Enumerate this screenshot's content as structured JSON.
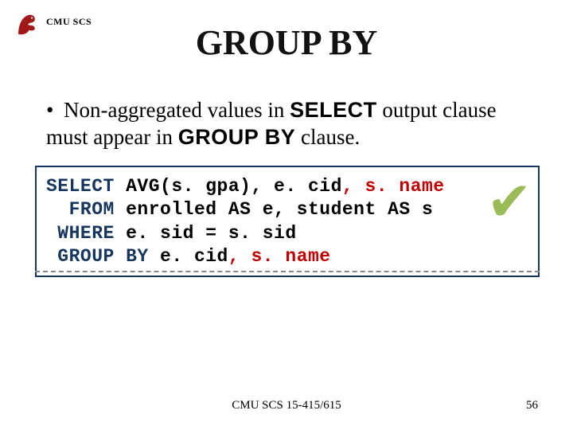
{
  "header": {
    "org": "CMU SCS"
  },
  "title": "GROUP BY",
  "bullet": {
    "pre": "Non-aggregated values in ",
    "kw1": "SELECT",
    "mid": " output clause must appear in ",
    "kw2": "GROUP BY",
    "post": " clause."
  },
  "code": {
    "l1_kw": "SELECT",
    "l1_rest": " AVG(s. gpa), e. cid",
    "l1_hl": ", s. name",
    "l2_kw": "  FROM",
    "l2_rest": " enrolled AS e, student AS s",
    "l3_kw": " WHERE",
    "l3_rest": " e. sid = s. sid",
    "l4_kw": " GROUP",
    "l4_by": " BY ",
    "l4_rest": "e. cid",
    "l4_hl": ", s. name"
  },
  "footer": {
    "center": "CMU SCS 15-415/615",
    "page": "56"
  }
}
